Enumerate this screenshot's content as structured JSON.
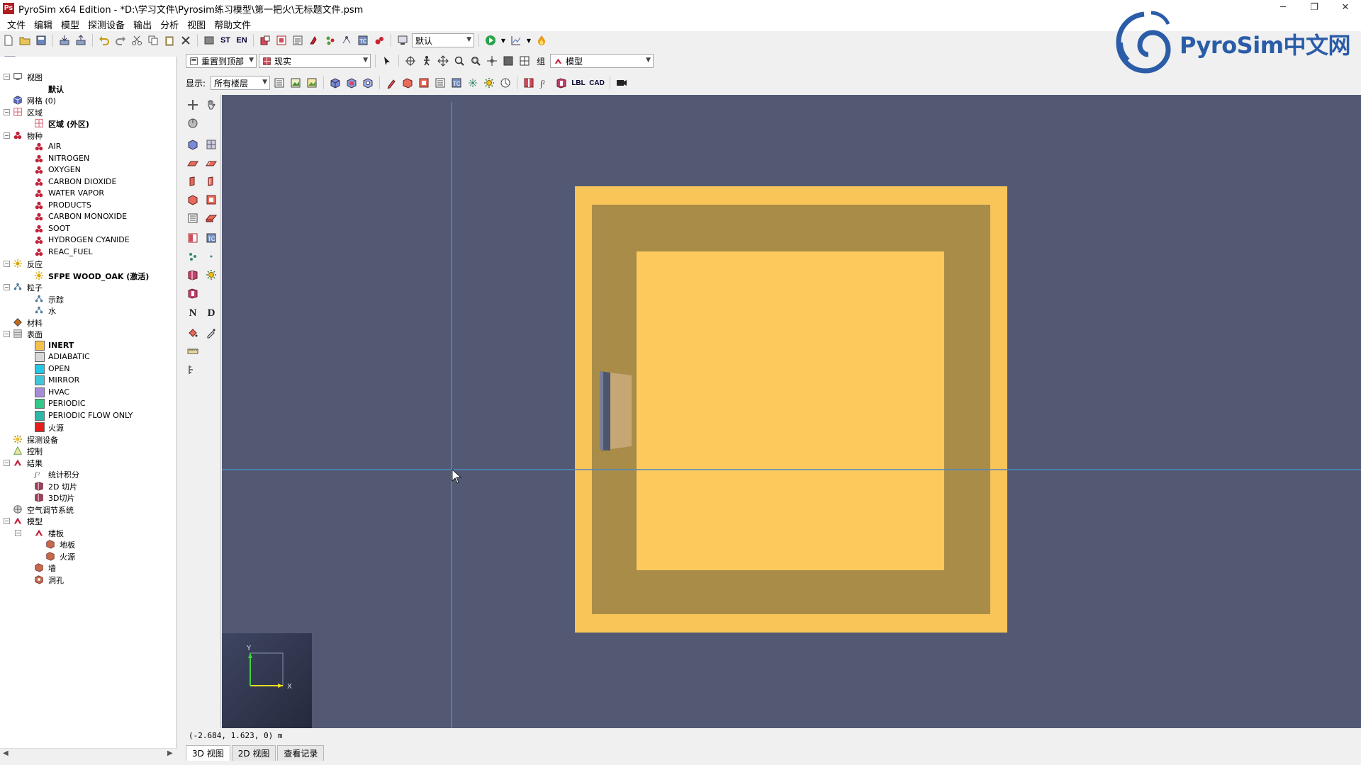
{
  "window": {
    "app_icon_text": "Ps",
    "title": "PyroSim x64 Edition - *D:\\学习文件\\Pyrosim练习模型\\第一把火\\无标题文件.psm",
    "controls": [
      "─",
      "❐",
      "✕"
    ]
  },
  "menu": [
    "文件",
    "编辑",
    "模型",
    "探测设备",
    "输出",
    "分析",
    "视图",
    "帮助文件"
  ],
  "toolbar1": {
    "st_label": "ST",
    "en_label": "EN",
    "default_combo": "默认"
  },
  "toolbar2": {
    "reset_label": "重置到顶部",
    "render_combo": "现实",
    "group_label": "组",
    "model_combo": "模型"
  },
  "toolbar3": {
    "display_label": "显示:",
    "floors_combo": "所有楼层",
    "lbl_label": "LBL",
    "cad_label": "CAD"
  },
  "logo": {
    "text": "PyroSim中文网"
  },
  "tree": [
    {
      "label": "视图",
      "level": 0,
      "exp": "−",
      "icon": "views-icon",
      "color": "#333"
    },
    {
      "label": "默认",
      "level": 1,
      "bold": true
    },
    {
      "label": "网格 (0)",
      "level": 0,
      "icon": "mesh-icon",
      "color": "#5b6bc9"
    },
    {
      "label": "区域",
      "level": 0,
      "exp": "−",
      "icon": "zone-icon",
      "color": "#d4455a"
    },
    {
      "label": "区域 (外区)",
      "level": 1,
      "bold": true,
      "icon": "zone-icon",
      "color": "#d4455a"
    },
    {
      "label": "物种",
      "level": 0,
      "exp": "−",
      "icon": "species-icon",
      "color": "#c0223a"
    },
    {
      "label": "AIR",
      "level": 1,
      "icon": "species-icon",
      "color": "#c0223a"
    },
    {
      "label": "NITROGEN",
      "level": 1,
      "icon": "species-icon",
      "color": "#c0223a"
    },
    {
      "label": "OXYGEN",
      "level": 1,
      "icon": "species-icon",
      "color": "#c0223a"
    },
    {
      "label": "CARBON DIOXIDE",
      "level": 1,
      "icon": "species-icon",
      "color": "#c0223a"
    },
    {
      "label": "WATER VAPOR",
      "level": 1,
      "icon": "species-icon",
      "color": "#c0223a"
    },
    {
      "label": "PRODUCTS",
      "level": 1,
      "icon": "species-icon",
      "color": "#c0223a"
    },
    {
      "label": "CARBON MONOXIDE",
      "level": 1,
      "icon": "species-icon",
      "color": "#c0223a"
    },
    {
      "label": "SOOT",
      "level": 1,
      "icon": "species-icon",
      "color": "#c0223a"
    },
    {
      "label": "HYDROGEN CYANIDE",
      "level": 1,
      "icon": "species-icon",
      "color": "#c0223a"
    },
    {
      "label": "REAC_FUEL",
      "level": 1,
      "icon": "species-icon",
      "color": "#c0223a"
    },
    {
      "label": "反应",
      "level": 0,
      "exp": "−",
      "icon": "reaction-icon",
      "color": "#d9a800"
    },
    {
      "label": "SFPE WOOD_OAK (激活)",
      "level": 1,
      "bold": true,
      "icon": "reaction-icon",
      "color": "#d9a800"
    },
    {
      "label": "粒子",
      "level": 0,
      "exp": "−",
      "icon": "particle-icon",
      "color": "#4a7a9a"
    },
    {
      "label": "示踪",
      "level": 1,
      "icon": "particle-icon",
      "color": "#4a7a9a"
    },
    {
      "label": "水",
      "level": 1,
      "icon": "particle-icon",
      "color": "#4a7a9a"
    },
    {
      "label": "材料",
      "level": 0,
      "icon": "material-icon",
      "color": "#c46a1a"
    },
    {
      "label": "表面",
      "level": 0,
      "exp": "−",
      "icon": "surface-icon",
      "color": "#777"
    },
    {
      "label": "INERT",
      "level": 1,
      "bold": true,
      "swatch": "#f5c04a"
    },
    {
      "label": "ADIABATIC",
      "level": 1,
      "swatch": "#d8d8d8"
    },
    {
      "label": "OPEN",
      "level": 1,
      "swatch": "#22c7e6"
    },
    {
      "label": "MIRROR",
      "level": 1,
      "swatch": "#3fc6d8"
    },
    {
      "label": "HVAC",
      "level": 1,
      "swatch": "#a58bd9"
    },
    {
      "label": "PERIODIC",
      "level": 1,
      "swatch": "#32c88a"
    },
    {
      "label": "PERIODIC FLOW ONLY",
      "level": 1,
      "swatch": "#2eb8a8"
    },
    {
      "label": "火源",
      "level": 1,
      "swatch": "#e81c1c"
    },
    {
      "label": "探测设备",
      "level": 0,
      "icon": "device-icon",
      "color": "#b08a00"
    },
    {
      "label": "控制",
      "level": 0,
      "icon": "control-icon",
      "color": "#5a9a3a"
    },
    {
      "label": "结果",
      "level": 0,
      "exp": "−",
      "icon": "output-icon",
      "color": "#c0223a"
    },
    {
      "label": "统计积分",
      "level": 1,
      "icon": "stats-icon",
      "color": "#555"
    },
    {
      "label": "2D 切片",
      "level": 1,
      "icon": "slice-icon",
      "color": "#a04060"
    },
    {
      "label": "3D切片",
      "level": 1,
      "icon": "slice-icon",
      "color": "#a04060"
    },
    {
      "label": "空气调节系统",
      "level": 0,
      "icon": "hvac-icon",
      "color": "#555"
    },
    {
      "label": "模型",
      "level": 0,
      "exp": "−",
      "icon": "model-icon",
      "color": "#c0223a"
    },
    {
      "label": "楼板",
      "level": 1,
      "exp": "−",
      "icon": "model-icon",
      "color": "#c0223a"
    },
    {
      "label": "地板",
      "level": 2,
      "icon": "obstruction-icon",
      "color": "#c46a4a"
    },
    {
      "label": "火源",
      "level": 2,
      "icon": "obstruction-icon",
      "color": "#c46a4a"
    },
    {
      "label": "墙",
      "level": 1,
      "icon": "obstruction-icon",
      "color": "#c46a4a"
    },
    {
      "label": "洞孔",
      "level": 1,
      "icon": "hole-icon",
      "color": "#c46a4a"
    }
  ],
  "viewport": {
    "background": "#535973",
    "floor_outer_color": "#f9c558",
    "floor_shadow_color": "#a98c48",
    "floor_inner_color": "#fdc95c",
    "axis_x_label": "X",
    "axis_y_label": "Y"
  },
  "status": {
    "coordinates": "(-2.684, 1.623, 0) m"
  },
  "tabs": [
    "3D 视图",
    "2D 视图",
    "查看记录"
  ]
}
